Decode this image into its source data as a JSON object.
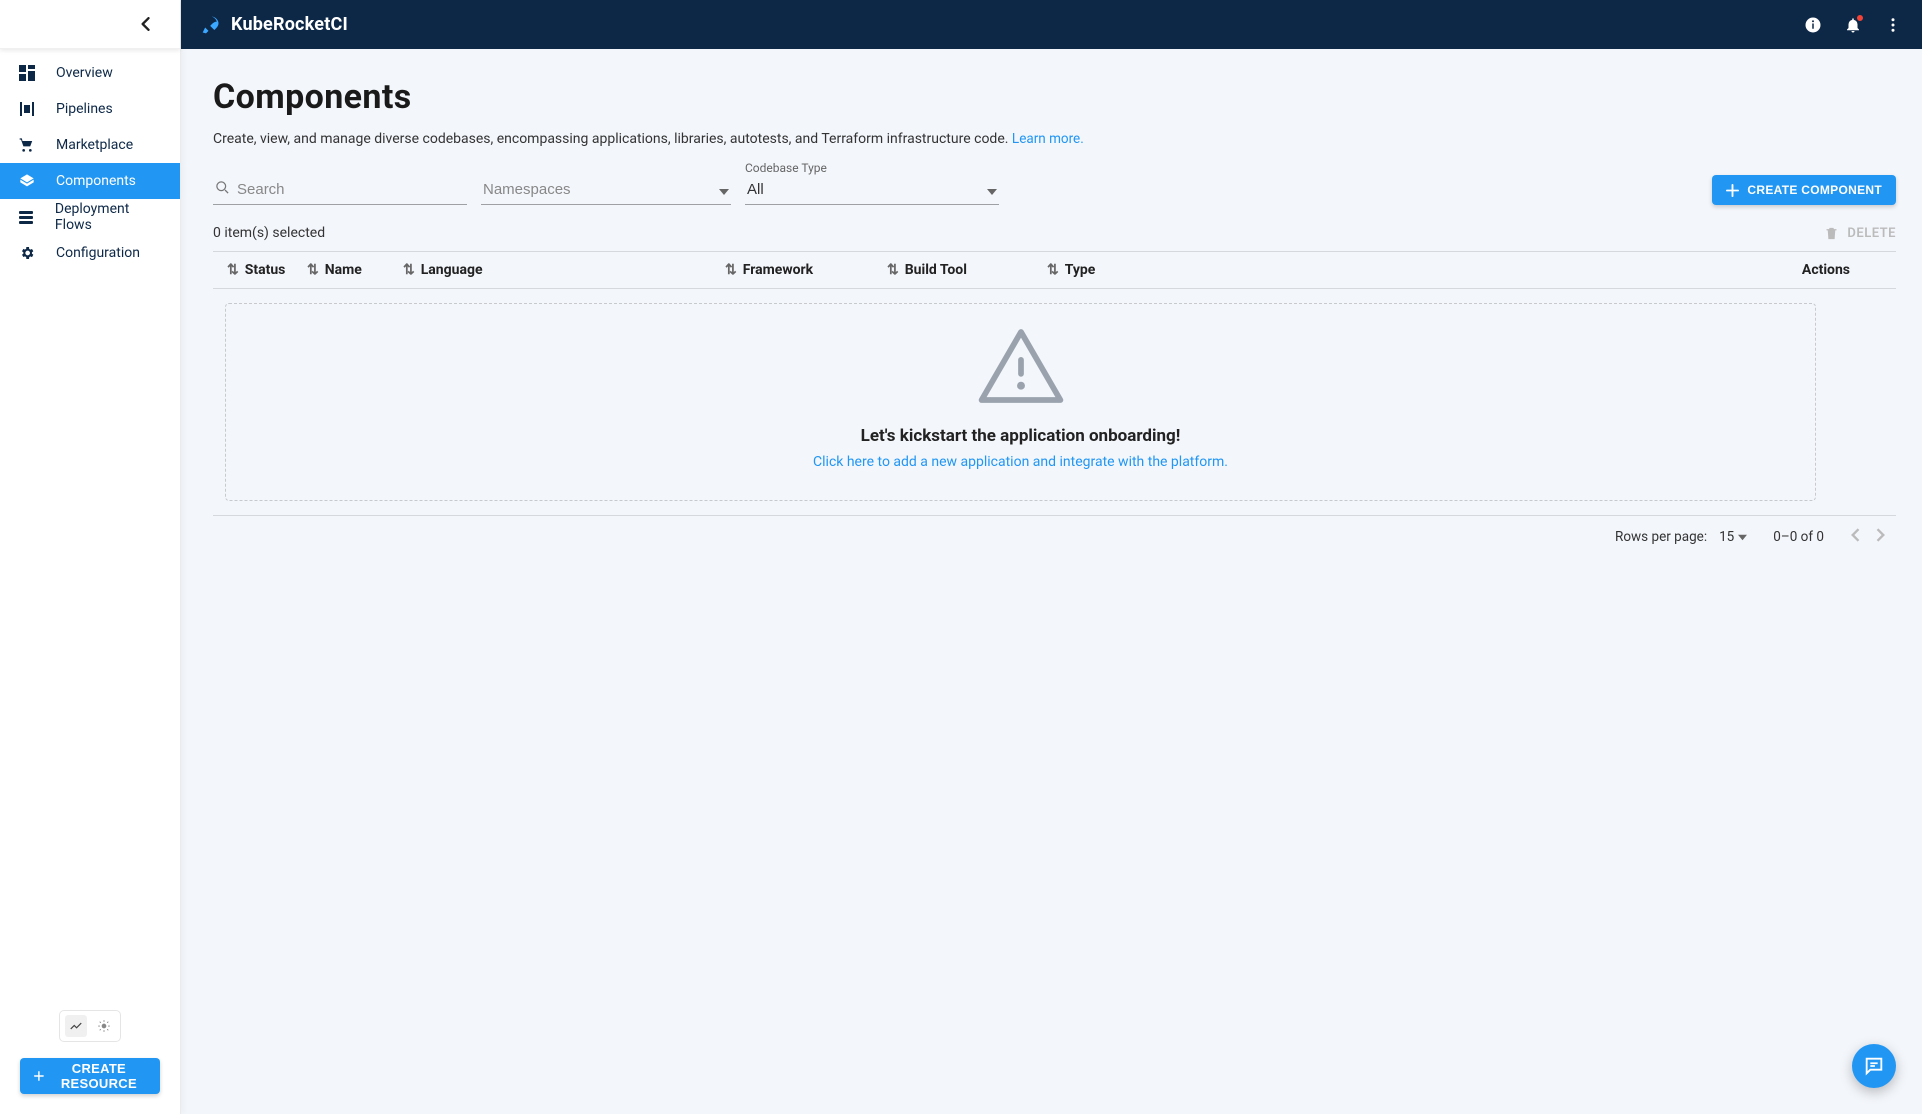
{
  "brand": "KubeRocketCI",
  "sidebar": {
    "items": [
      {
        "label": "Overview"
      },
      {
        "label": "Pipelines"
      },
      {
        "label": "Marketplace"
      },
      {
        "label": "Components"
      },
      {
        "label": "Deployment Flows"
      },
      {
        "label": "Configuration"
      }
    ],
    "create_resource": "CREATE RESOURCE"
  },
  "page": {
    "title": "Components",
    "subtitle": "Create, view, and manage diverse codebases, encompassing applications, libraries, autotests, and Terraform infrastructure code.",
    "learn_more": "Learn more."
  },
  "filters": {
    "search_placeholder": "Search",
    "namespaces_placeholder": "Namespaces",
    "codebase_type_label": "Codebase Type",
    "codebase_type_value": "All",
    "create_component": "CREATE COMPONENT"
  },
  "toolbar": {
    "selection": "0 item(s) selected",
    "delete": "DELETE"
  },
  "columns": {
    "status": "Status",
    "name": "Name",
    "language": "Language",
    "framework": "Framework",
    "build_tool": "Build Tool",
    "type": "Type",
    "actions": "Actions"
  },
  "empty": {
    "title": "Let's kickstart the application onboarding!",
    "link": "Click here to add a new application and integrate with the platform."
  },
  "pagination": {
    "rows_label": "Rows per page:",
    "rows_value": "15",
    "range": "0–0 of 0"
  }
}
